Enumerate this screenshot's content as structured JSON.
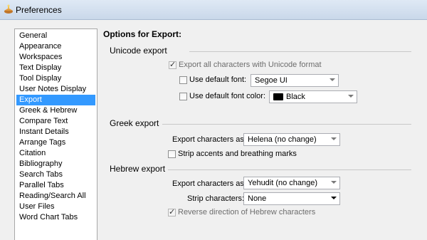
{
  "window": {
    "title": "Preferences",
    "icon": "app-lamp-icon"
  },
  "sidebar": {
    "items": [
      {
        "label": "General",
        "selected": false
      },
      {
        "label": "Appearance",
        "selected": false
      },
      {
        "label": "Workspaces",
        "selected": false
      },
      {
        "label": "Text Display",
        "selected": false
      },
      {
        "label": "Tool Display",
        "selected": false
      },
      {
        "label": "User Notes Display",
        "selected": false
      },
      {
        "label": "Export",
        "selected": true
      },
      {
        "label": "Greek & Hebrew",
        "selected": false
      },
      {
        "label": "Compare Text",
        "selected": false
      },
      {
        "label": "Instant Details",
        "selected": false
      },
      {
        "label": "Arrange Tags",
        "selected": false
      },
      {
        "label": "Citation",
        "selected": false
      },
      {
        "label": "Bibliography",
        "selected": false
      },
      {
        "label": "Search Tabs",
        "selected": false
      },
      {
        "label": "Parallel Tabs",
        "selected": false
      },
      {
        "label": "Reading/Search All",
        "selected": false
      },
      {
        "label": "User Files",
        "selected": false
      },
      {
        "label": "Word Chart Tabs",
        "selected": false
      }
    ]
  },
  "main": {
    "heading": "Options for Export:",
    "unicode": {
      "title": "Unicode export",
      "export_all": {
        "label": "Export all characters with Unicode format",
        "checked": true,
        "enabled": false
      },
      "default_font": {
        "label": "Use default font:",
        "checked": false,
        "value": "Segoe UI"
      },
      "default_color": {
        "label": "Use default font color:",
        "checked": false,
        "value": "Black",
        "swatch": "#000000"
      }
    },
    "greek": {
      "title": "Greek export",
      "export_as": {
        "label": "Export characters as:",
        "value": "Helena (no change)"
      },
      "strip_accents": {
        "label": "Strip accents and breathing marks",
        "checked": false
      }
    },
    "hebrew": {
      "title": "Hebrew export",
      "export_as": {
        "label": "Export characters as:",
        "value": "Yehudit (no change)"
      },
      "strip_chars": {
        "label": "Strip characters:",
        "value": "None"
      },
      "reverse": {
        "label": "Reverse direction of Hebrew characters",
        "checked": true,
        "enabled": false
      }
    }
  },
  "colors": {
    "selection": "#3399ff",
    "separator": "#c8c8c8"
  }
}
